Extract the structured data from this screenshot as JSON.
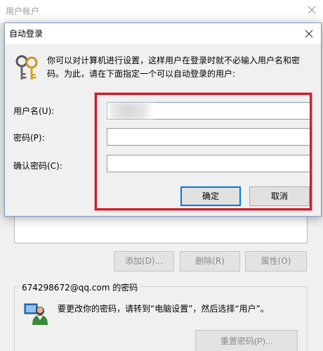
{
  "background_window": {
    "title": "用户帐户",
    "buttons": {
      "add": "添加(D)...",
      "remove": "删除(R)",
      "properties": "属性(O)"
    },
    "password_group": {
      "legend": "674298672@qq.com 的密码",
      "instruction": "要更改你的密码，请转到“电脑设置”，然后选择“用户”。",
      "reset_button": "重置密码(P)..."
    }
  },
  "dialog": {
    "title": "自动登录",
    "description": "你可以对计算机进行设置，这样用户在登录时就不必输入用户名和密码。为此，请在下面指定一个可以自动登录的用户:",
    "fields": {
      "user_name": {
        "label": "用户名(U):",
        "value": ""
      },
      "password": {
        "label": "密码(P):",
        "value": ""
      },
      "confirm_password": {
        "label": "确认密码(C):",
        "value": ""
      }
    },
    "buttons": {
      "ok": "确定",
      "cancel": "取消"
    }
  },
  "colors": {
    "highlight": "#d11a2a",
    "focus_blue": "#0078d7",
    "window_bg": "#f0f0f0"
  },
  "icons": [
    "close-icon",
    "keys-icon",
    "user-icon"
  ]
}
